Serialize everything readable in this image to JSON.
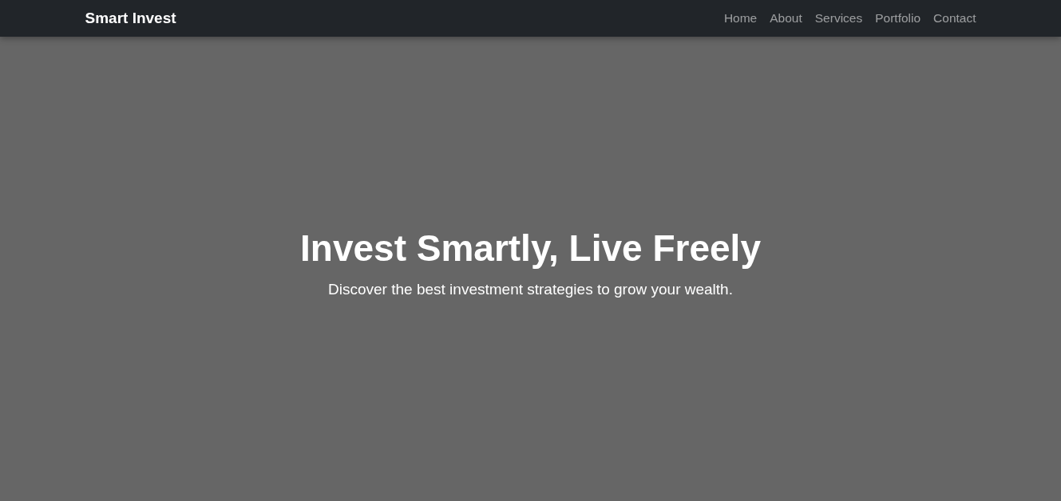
{
  "navbar": {
    "brand": "Smart Invest",
    "links": [
      {
        "label": "Home"
      },
      {
        "label": "About"
      },
      {
        "label": "Services"
      },
      {
        "label": "Portfolio"
      },
      {
        "label": "Contact"
      }
    ]
  },
  "hero": {
    "title": "Invest Smartly, Live Freely",
    "subtitle": "Discover the best investment strategies to grow your wealth."
  }
}
